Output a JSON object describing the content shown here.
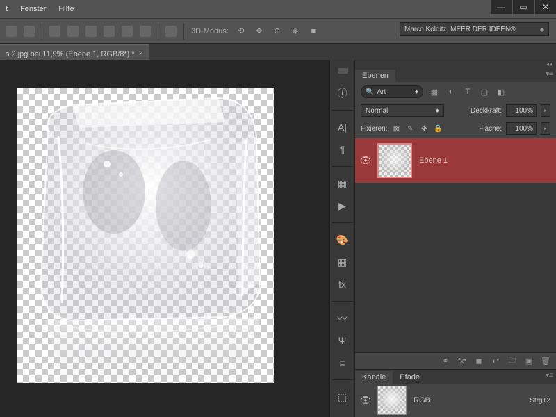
{
  "menu": {
    "window": "Fenster",
    "help": "Hilfe"
  },
  "optbar": {
    "mode_label": "3D-Modus:"
  },
  "workspace": {
    "name": "Marco Kolditz, MEER DER IDEEN®"
  },
  "document": {
    "tab_title": "s 2.jpg bei 11,9% (Ebene 1, RGB/8*) *"
  },
  "panels": {
    "layers": {
      "title": "Ebenen",
      "search_label": "Art",
      "blend_mode": "Normal",
      "opacity_label": "Deckkraft:",
      "opacity_value": "100%",
      "lock_label": "Fixieren:",
      "fill_label": "Fläche:",
      "fill_value": "100%",
      "items": [
        {
          "name": "Ebene 1",
          "visible": true,
          "selected": true
        }
      ]
    },
    "channels": {
      "title": "Kanäle",
      "paths_title": "Pfade",
      "items": [
        {
          "name": "RGB",
          "shortcut": "Strg+2"
        }
      ]
    }
  }
}
